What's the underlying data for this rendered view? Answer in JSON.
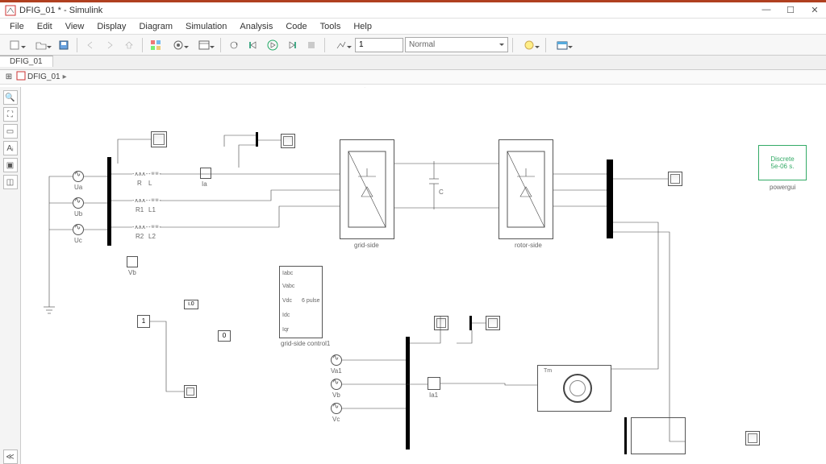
{
  "window": {
    "title": "DFIG_01 * - Simulink"
  },
  "menu": {
    "file": "File",
    "edit": "Edit",
    "view": "View",
    "display": "Display",
    "diagram": "Diagram",
    "simulation": "Simulation",
    "analysis": "Analysis",
    "code": "Code",
    "tools": "Tools",
    "help": "Help"
  },
  "toolbar": {
    "stop_time": "1",
    "sim_mode": "Normal"
  },
  "tabs": {
    "t1": "DFIG_01"
  },
  "breadcrumb": {
    "root": "DFIG_01"
  },
  "labels": {
    "ua": "Ua",
    "ub": "Ub",
    "uc": "Uc",
    "r": "R",
    "l": "L",
    "r1": "R1",
    "l1": "L1",
    "r2": "R2",
    "l2": "L2",
    "ia": "Ia",
    "vb_s": "Vb",
    "c": "C",
    "grid_side": "grid-side",
    "rotor_side": "rotor-side",
    "powergui1": "Discrete",
    "powergui2": "5e-06 s.",
    "powergui3": "powergui",
    "gs_ctrl": "grid-side control1",
    "iabc": "Iabc",
    "vabc": "Vabc",
    "vdc": "Vdc",
    "idc": "Idc",
    "iqr": "Iqr",
    "six_pulse": "6 pulse",
    "t_label": "Tm",
    "v_a": "Va1",
    "v_b": "Vb",
    "v_c": "Vc",
    "ia1": "Ia1",
    "one": "1",
    "zero": "0",
    "izero": "i.0"
  }
}
